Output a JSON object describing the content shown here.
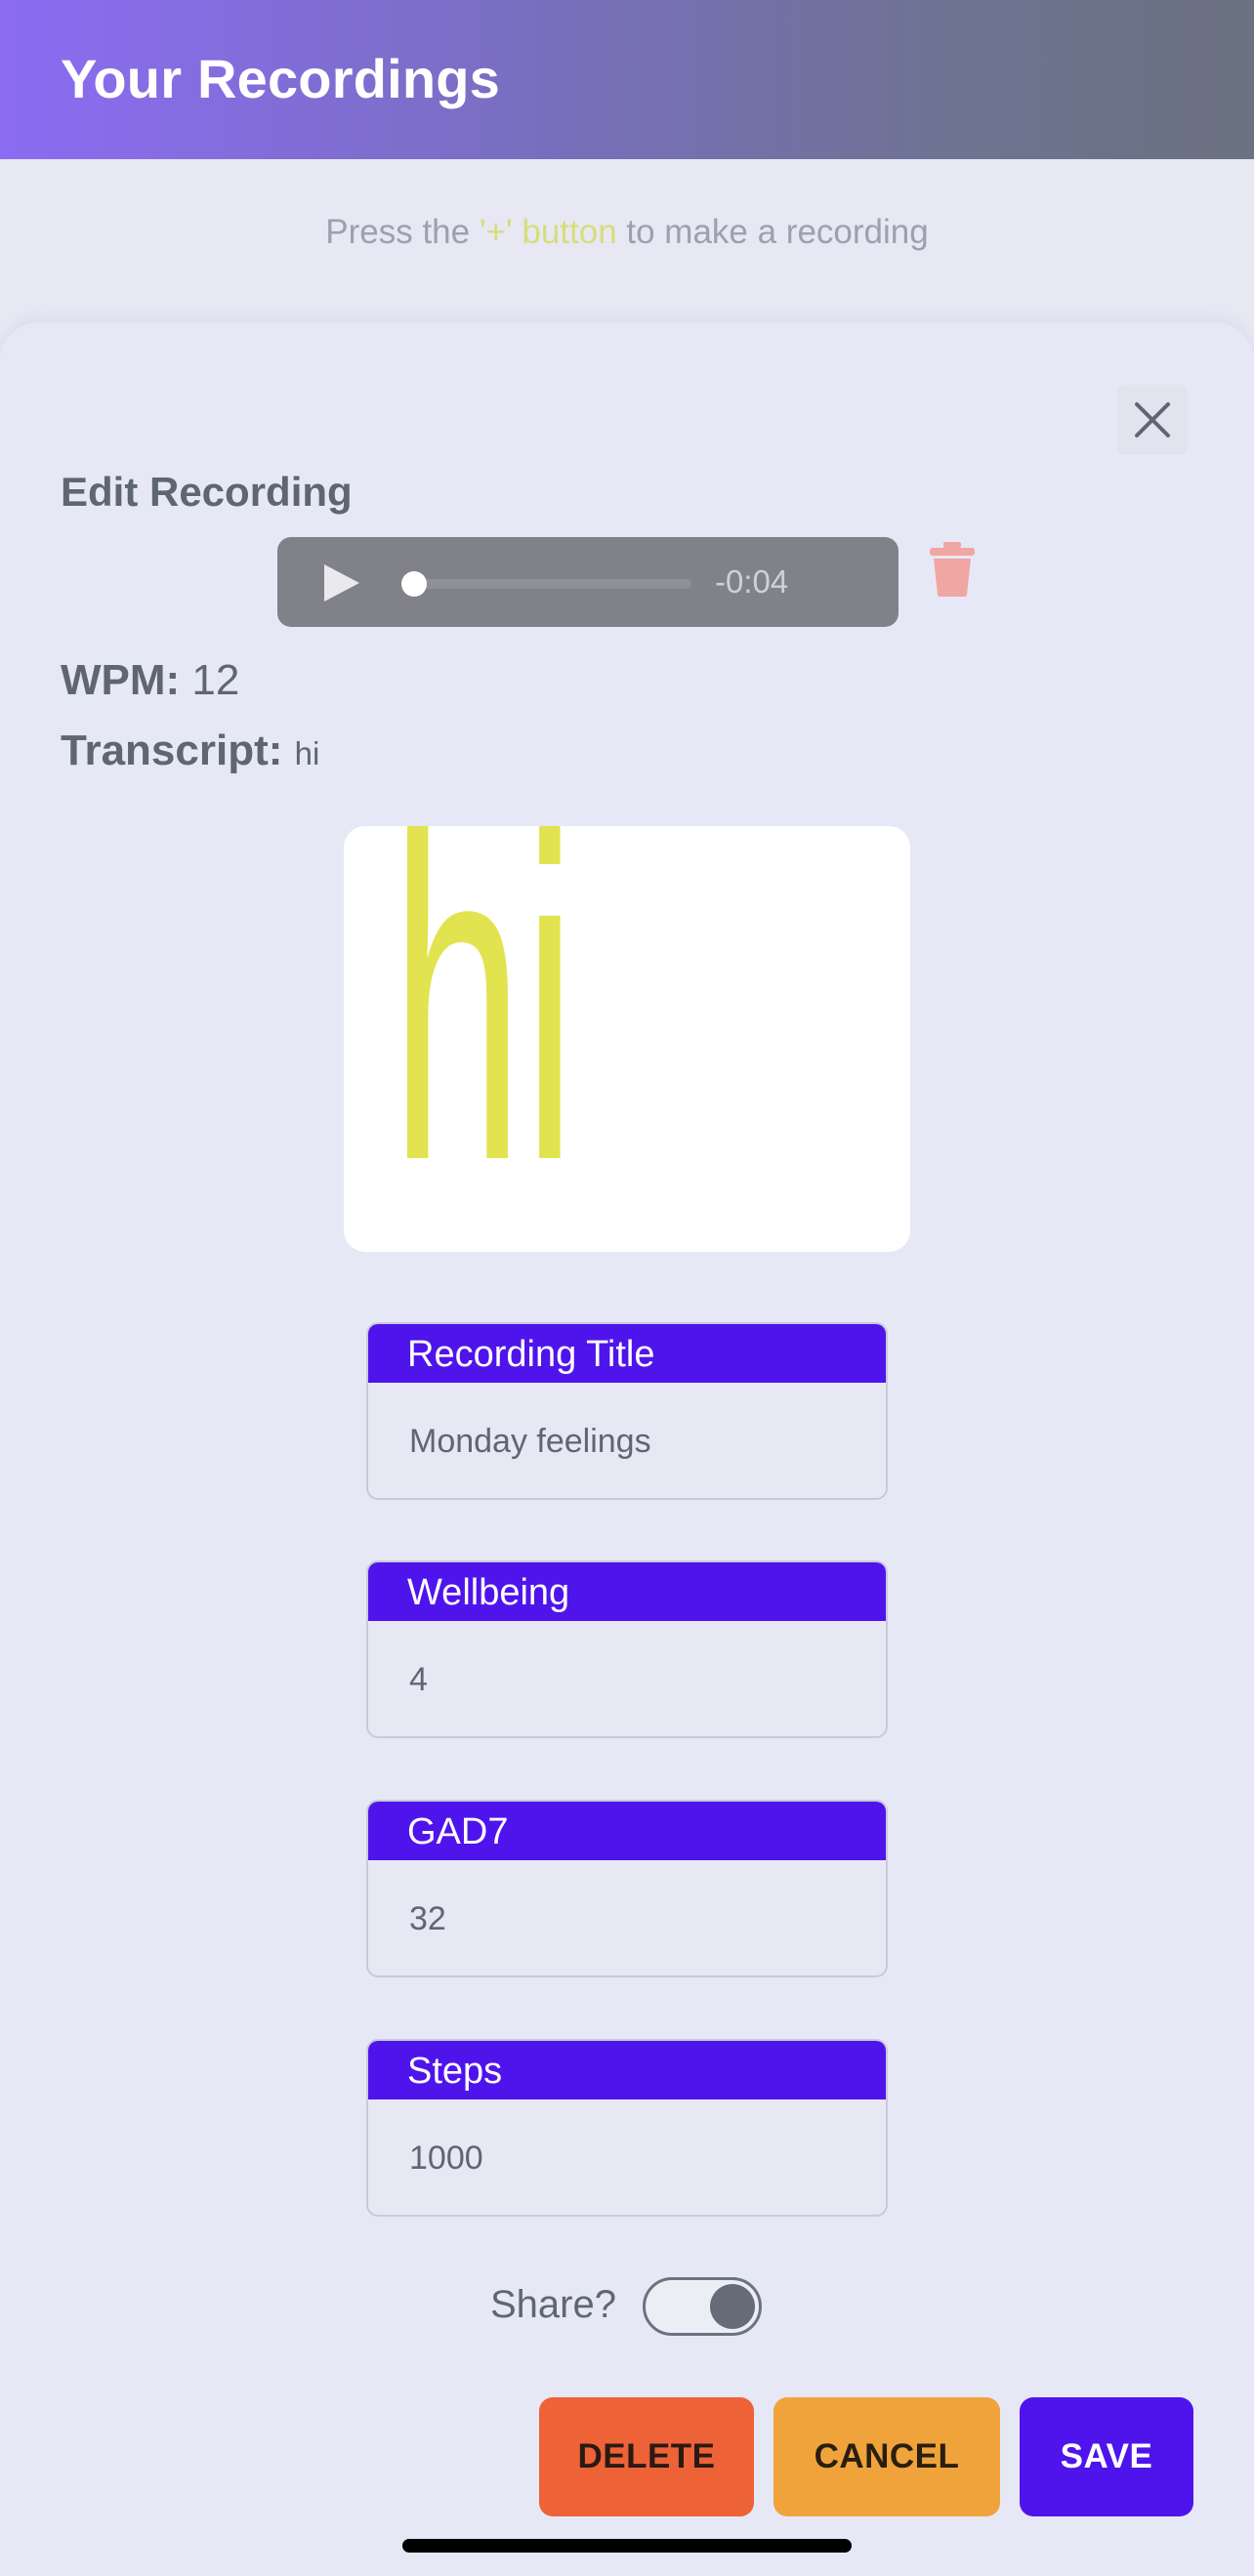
{
  "header": {
    "title": "Your Recordings"
  },
  "hint": {
    "prefix": "Press the ",
    "accent": "'+' button",
    "suffix": " to make a recording"
  },
  "sheet": {
    "title": "Edit Recording",
    "close_icon": "close-icon",
    "player": {
      "play_icon": "play-icon",
      "time_remaining": "-0:04",
      "progress": 0.0
    },
    "delete_icon": "trash-icon",
    "wpm_label": "WPM:",
    "wpm_value": "12",
    "transcript_label": "Transcript:",
    "transcript_value": "hi",
    "word_cloud": {
      "words": [
        "hi"
      ],
      "color": "#e1e34f"
    },
    "fields": [
      {
        "label": "Recording Title",
        "value": "Monday feelings"
      },
      {
        "label": "Wellbeing",
        "value": "4"
      },
      {
        "label": "GAD7",
        "value": "32"
      },
      {
        "label": "Steps",
        "value": "1000"
      }
    ],
    "share": {
      "label": "Share?",
      "on": true
    },
    "buttons": {
      "delete": "DELETE",
      "cancel": "CANCEL",
      "save": "SAVE"
    }
  },
  "colors": {
    "accent": "#4f14ec",
    "delete": "#ee6237",
    "cancel": "#f1a33b"
  }
}
